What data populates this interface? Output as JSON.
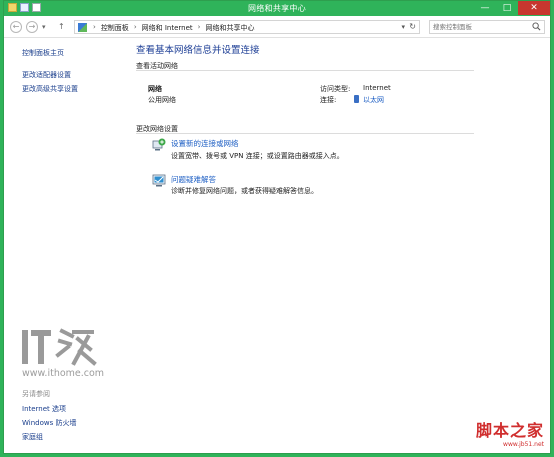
{
  "window": {
    "title": "网络和共享中心",
    "controls": {
      "minimize": "—",
      "maximize": "□",
      "close": "✕"
    }
  },
  "navbar": {
    "back": "←",
    "forward": "→",
    "history": "▾",
    "up": "↑",
    "breadcrumb": [
      "控制面板",
      "网络和 Internet",
      "网络和共享中心"
    ],
    "separator": "›",
    "dropdown": "▾",
    "refresh": "↻",
    "search_placeholder": "搜索控制面板"
  },
  "sidebar": {
    "links": [
      "控制面板主页",
      "更改适配器设置",
      "更改高级共享设置"
    ],
    "see_also_header": "另请参阅",
    "see_also": [
      "Internet 选项",
      "Windows 防火墙",
      "家庭组"
    ],
    "logo_url": "www.ithome.com"
  },
  "main": {
    "title": "查看基本网络信息并设置连接",
    "active_networks_label": "查看活动网络",
    "network_name": "网络",
    "network_type": "公用网络",
    "access_type_label": "访问类型:",
    "access_type_value": "Internet",
    "connection_label": "连接:",
    "connection_value": "以太网",
    "change_settings_label": "更改网络设置",
    "tasks": [
      {
        "title": "设置新的连接或网络",
        "desc": "设置宽带、拨号或 VPN 连接；或设置路由器或接入点。",
        "icon": "new-connection-icon"
      },
      {
        "title": "问题疑难解答",
        "desc": "诊断并修复网络问题，或者获得疑难解答信息。",
        "icon": "troubleshoot-icon"
      }
    ]
  },
  "watermark": {
    "main": "脚本之家",
    "url": "www.jb51.net"
  },
  "colors": {
    "titlebar": "#2fb35a",
    "link": "#1e5fc4",
    "heading": "#1e3f96",
    "close": "#c7372f"
  }
}
